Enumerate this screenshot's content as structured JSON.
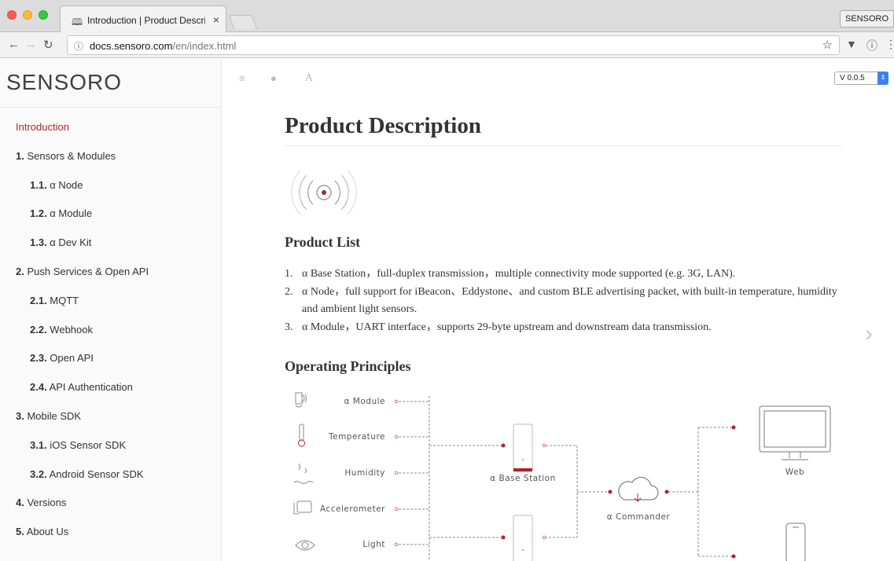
{
  "browser": {
    "tab_title": "Introduction | Product Descrip",
    "tab_close": "×",
    "profile": "SENSORO",
    "url_host": "docs.sensoro.com",
    "url_path": "/en/index.html"
  },
  "sidebar": {
    "brand": "SENSORO",
    "items": [
      {
        "num": "",
        "label": "Introduction"
      },
      {
        "num": "1.",
        "label": " Sensors & Modules"
      },
      {
        "num": "1.1.",
        "label": " α Node"
      },
      {
        "num": "1.2.",
        "label": " α Module"
      },
      {
        "num": "1.3.",
        "label": " α Dev Kit"
      },
      {
        "num": "2.",
        "label": " Push Services & Open API"
      },
      {
        "num": "2.1.",
        "label": " MQTT"
      },
      {
        "num": "2.2.",
        "label": " Webhook"
      },
      {
        "num": "2.3.",
        "label": " Open API"
      },
      {
        "num": "2.4.",
        "label": " API Authentication"
      },
      {
        "num": "3.",
        "label": " Mobile SDK"
      },
      {
        "num": "3.1.",
        "label": " iOS Sensor SDK"
      },
      {
        "num": "3.2.",
        "label": " Android Sensor SDK"
      },
      {
        "num": "4.",
        "label": " Versions"
      },
      {
        "num": "5.",
        "label": " About Us"
      }
    ]
  },
  "toolbar": {
    "version": "V 0.0.5"
  },
  "content": {
    "title": "Product Description",
    "product_list_heading": "Product List",
    "products": [
      {
        "num": "1.",
        "text": "α Base Station，full-duplex transmission，multiple connectivity mode supported (e.g. 3G, LAN)."
      },
      {
        "num": "2.",
        "text": "α Node，full support for iBeacon、Eddystone、and custom BLE advertising packet, with built-in temperature, humidity and ambient light sensors."
      },
      {
        "num": "3.",
        "text": "α Module，UART interface，supports 29-byte upstream and downstream data transmission."
      }
    ],
    "operating_heading": "Operating Principles"
  },
  "diagram": {
    "sensors": [
      "α Module",
      "Temperature",
      "Humidity",
      "Accelerometer",
      "Light"
    ],
    "base_station": "α Base Station",
    "commander": "α Commander",
    "web": "Web"
  },
  "colors": {
    "accent": "#b0232a"
  }
}
